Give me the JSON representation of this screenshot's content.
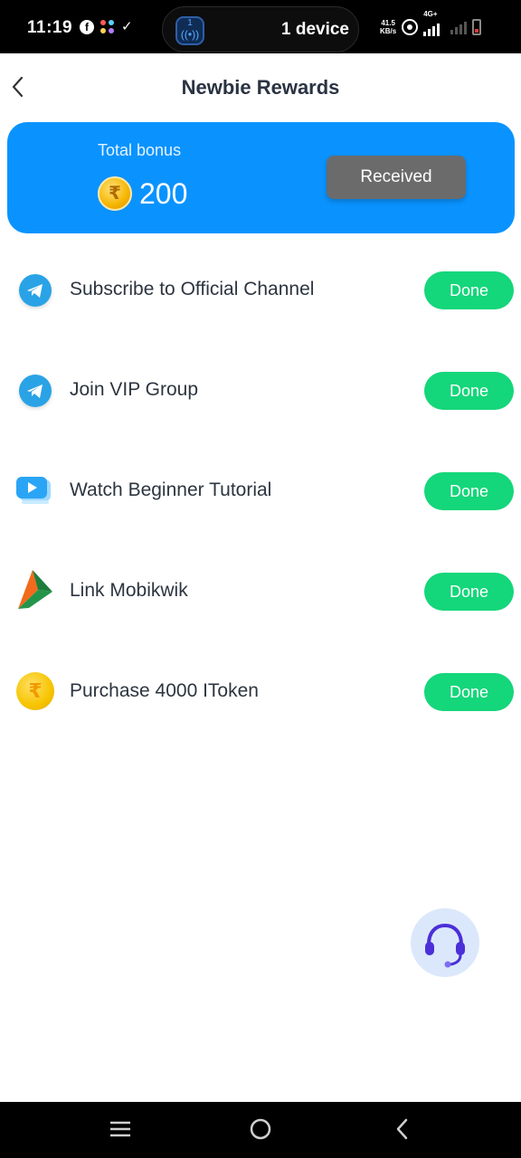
{
  "status_bar": {
    "time": "11:19",
    "island_text": "1 device",
    "island_badge": "1",
    "speed_value": "41.5",
    "speed_unit": "KB/s",
    "network": "4G+"
  },
  "header": {
    "title": "Newbie Rewards"
  },
  "bonus": {
    "label": "Total bonus",
    "amount": "200",
    "currency_symbol": "₹",
    "button_label": "Received"
  },
  "tasks": [
    {
      "label": "Subscribe to Official Channel",
      "button": "Done",
      "icon": "telegram-icon"
    },
    {
      "label": "Join VIP Group",
      "button": "Done",
      "icon": "telegram-icon"
    },
    {
      "label": "Watch Beginner Tutorial",
      "button": "Done",
      "icon": "video-icon"
    },
    {
      "label": "Link Mobikwik",
      "button": "Done",
      "icon": "mobikwik-icon"
    },
    {
      "label": "Purchase 4000 IToken",
      "button": "Done",
      "icon": "rupee-coin-icon"
    }
  ],
  "colors": {
    "accent_blue": "#0a93ff",
    "done_green": "#14d67a",
    "received_gray": "#6b6b6b"
  }
}
